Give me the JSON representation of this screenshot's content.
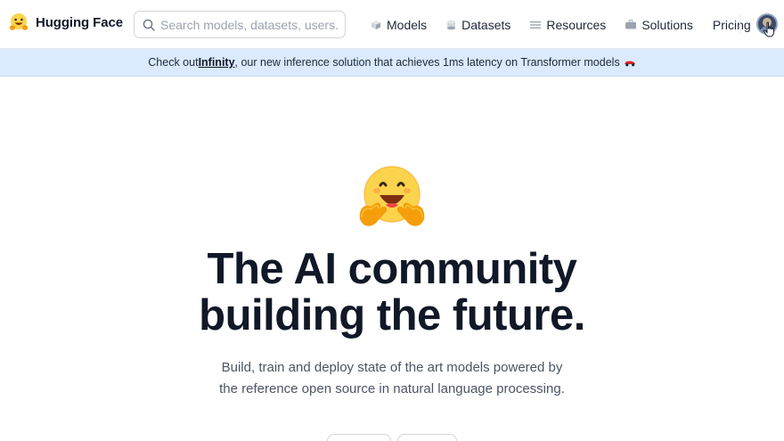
{
  "brand": {
    "name": "Hugging Face",
    "logo_icon": "hugging-face-logo-icon"
  },
  "search": {
    "placeholder": "Search models, datasets, users..."
  },
  "nav": {
    "items": [
      {
        "label": "Models",
        "icon": "cube-icon"
      },
      {
        "label": "Datasets",
        "icon": "database-icon"
      },
      {
        "label": "Resources",
        "icon": "menu-lines-icon"
      },
      {
        "label": "Solutions",
        "icon": "briefcase-icon"
      },
      {
        "label": "Pricing"
      }
    ]
  },
  "banner": {
    "prefix": "Check out ",
    "link": "Infinity",
    "suffix": ", our new inference solution that achieves 1ms latency on Transformer models",
    "icon": "race-car-icon"
  },
  "hero": {
    "title_line1": "The AI community",
    "title_line2": "building the future.",
    "subtitle_line1": "Build, train and deploy state of the art models powered by",
    "subtitle_line2": "the reference open source in natural language processing."
  },
  "colors": {
    "banner_bg": "#dbeafe",
    "emoji_yellow": "#fcd34d",
    "emoji_orange": "#f59e0b",
    "text_dark": "#111827",
    "text_muted": "#4b5563"
  }
}
